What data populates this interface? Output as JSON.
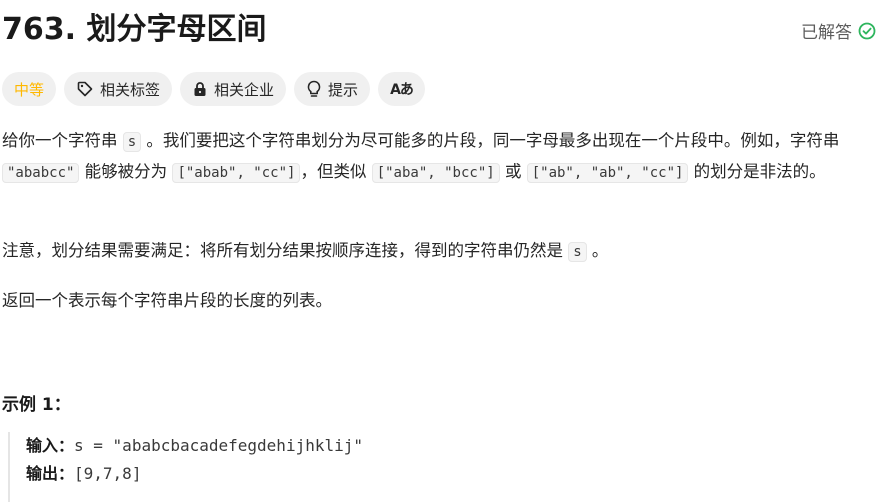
{
  "problem": {
    "title": "763. 划分字母区间",
    "status": "已解答"
  },
  "tags": {
    "difficulty": "中等",
    "related_tags": "相关标签",
    "related_companies": "相关企业",
    "hint": "提示",
    "translate": "Aあ"
  },
  "description": {
    "p1_a": "给你一个字符串 ",
    "p1_code1": "s",
    "p1_b": " 。我们要把这个字符串划分为尽可能多的片段，同一字母最多出现在一个片段中。例如，字符串 ",
    "p1_code2": "\"ababcc\"",
    "p1_c": " 能够被分为 ",
    "p1_code3": "[\"abab\", \"cc\"]",
    "p1_d": "，但类似 ",
    "p1_code4": "[\"aba\", \"bcc\"]",
    "p1_e": " 或 ",
    "p1_code5": "[\"ab\", \"ab\", \"cc\"]",
    "p1_f": " 的划分是非法的。",
    "p2_a": "注意，划分结果需要满足：将所有划分结果按顺序连接，得到的字符串仍然是 ",
    "p2_code": "s",
    "p2_b": " 。",
    "p3": "返回一个表示每个字符串片段的长度的列表。"
  },
  "example1": {
    "title": "示例 1：",
    "input_label": "输入：",
    "input_value": "s = \"ababcbacadefegdehijhklij\"",
    "output_label": "输出：",
    "output_value": "[9,7,8]"
  },
  "colors": {
    "difficulty": "#ffb800",
    "solved_check": "#2db55d"
  },
  "icons": [
    "check-circle-icon",
    "tag-icon",
    "lock-icon",
    "lightbulb-icon",
    "translate-icon"
  ]
}
